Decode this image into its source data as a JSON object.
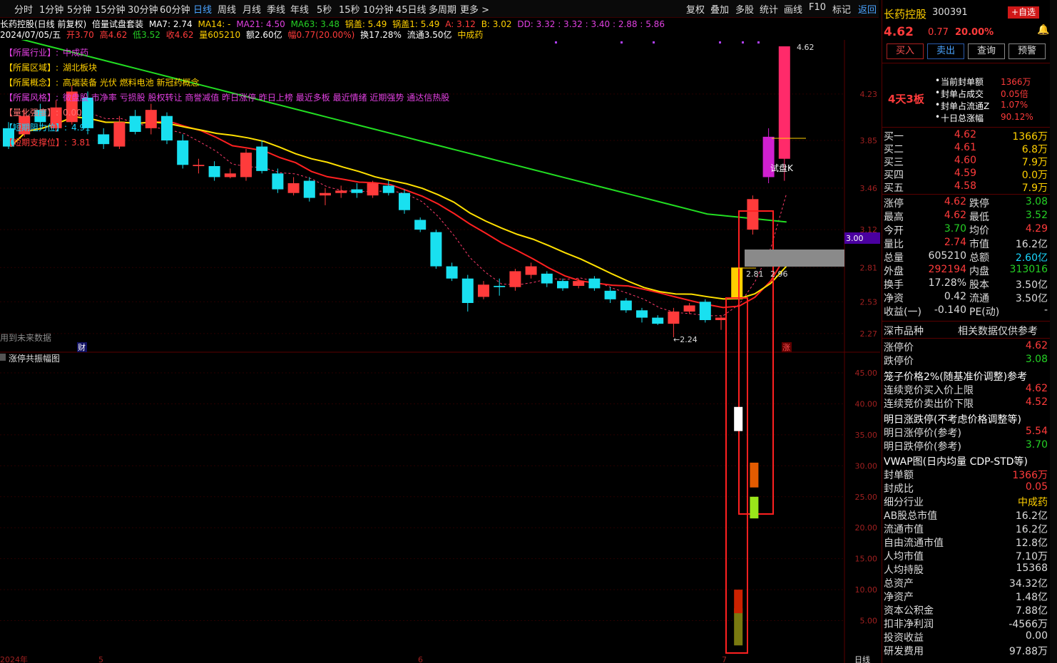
{
  "toolbar": {
    "periods": [
      "分时",
      "1分钟",
      "5分钟",
      "15分钟",
      "30分钟",
      "60分钟",
      "日线",
      "周线",
      "月线",
      "季线",
      "年线",
      "5秒",
      "15秒",
      "10分钟",
      "45日线",
      "多周期",
      "更多 >"
    ],
    "active_period": "日线",
    "tools": [
      "复权",
      "叠加",
      "多股",
      "统计",
      "画线",
      "F10",
      "标记",
      "返回"
    ],
    "active_tool": "返回"
  },
  "info_line1": {
    "stock": "长药控股(日线 前复权)",
    "indicator": "倍量试盘套装",
    "ma7": "MA7: 2.74",
    "ma14": "MA14: -",
    "ma21": "MA21: 4.50",
    "ma63": "MA63: 3.48",
    "guogai": "锅盖: 5.49",
    "guodi": "锅盖1: 5.49",
    "a": "A: 3.12",
    "b": "B: 3.02",
    "dd": "DD: 3.32 : 3.32 : 3.40 : 2.88 : 5.86"
  },
  "info_line2": {
    "date": "2024/07/05/五",
    "open": "开3.70",
    "high": "高4.62",
    "low": "低3.52",
    "close": "收4.62",
    "vol": "量605210",
    "amount": "额2.60亿",
    "range": "幅0.77(20.00%)",
    "turnover": "换17.28%",
    "float": "流通3.50亿",
    "sector": "中成药"
  },
  "attributes": [
    {
      "label": "【所属行业】:",
      "value": "中成药",
      "color": "#e040e0"
    },
    {
      "label": "【所属区域】:",
      "value": "湖北板块",
      "color": "#ffd000"
    },
    {
      "label": "【所属概念】:",
      "value": "高端装备 光伏 燃料电池 新冠药概念",
      "color": "#ffd000"
    },
    {
      "label": "【所属风格】:",
      "value": "微盘股 市净率 亏损股 股权转让 商誉减值 昨日涨停 昨日上榜 最近多板 最近情绪 近期强势 通达信热股",
      "color": "#e040e0"
    },
    {
      "label": "【量化强度】:",
      "value": "0.00",
      "color": "#ff7070"
    },
    {
      "label": "【短期阻力位】:",
      "value": "4.91",
      "color": "#19d7ff"
    },
    {
      "label": "【短期支撑位】:",
      "value": "3.81",
      "color": "#ff3b3b"
    }
  ],
  "chart_labels": {
    "future_data": "用到未来数据",
    "cai": "财",
    "zhang": "涨",
    "trial_k": "试盘K",
    "high_mark": "4.62",
    "low_mark": "←2.24",
    "v281": "2.81",
    "v296": "2.96",
    "sub_title": "涨停共振幅图",
    "price_tag": "3.00",
    "date_left": "2024年",
    "date_mid1": "5",
    "date_mid2": "6",
    "date_mid3": "7",
    "corner": "日线"
  },
  "price_axis": [
    "4.23",
    "3.85",
    "3.46",
    "3.12",
    "2.81",
    "2.53",
    "2.27"
  ],
  "sub_axis": [
    "45.00",
    "40.00",
    "35.00",
    "30.00",
    "25.00",
    "20.00",
    "15.00",
    "10.00",
    "5.00"
  ],
  "quote": {
    "name": "长药控股",
    "code": "300391",
    "add_btn": "+自选",
    "price": "4.62",
    "change": "0.77",
    "pct": "20.00%",
    "buttons": [
      "买入",
      "卖出",
      "查询",
      "预警"
    ],
    "board": "4天3板",
    "seal": [
      {
        "label": "当前封单额",
        "value": "1366万"
      },
      {
        "label": "封单占成交",
        "value": "0.05倍"
      },
      {
        "label": "封单占流通Z",
        "value": "1.07%"
      },
      {
        "label": "十日总涨幅",
        "value": "90.12%"
      }
    ],
    "bids": [
      {
        "label": "买一",
        "price": "4.62",
        "vol": "1366万"
      },
      {
        "label": "买二",
        "price": "4.61",
        "vol": "6.8万"
      },
      {
        "label": "买三",
        "price": "4.60",
        "vol": "7.9万"
      },
      {
        "label": "买四",
        "price": "4.59",
        "vol": "0.0万"
      },
      {
        "label": "买五",
        "price": "4.58",
        "vol": "7.9万"
      }
    ],
    "stats": [
      {
        "l1": "涨停",
        "v1": "4.62",
        "c1": "#ff3b3b",
        "l2": "跌停",
        "v2": "3.08",
        "c2": "#25d025"
      },
      {
        "l1": "最高",
        "v1": "4.62",
        "c1": "#ff3b3b",
        "l2": "最低",
        "v2": "3.52",
        "c2": "#25d025"
      },
      {
        "l1": "今开",
        "v1": "3.70",
        "c1": "#25d025",
        "l2": "均价",
        "v2": "4.29",
        "c2": "#ff3b3b"
      },
      {
        "l1": "量比",
        "v1": "2.74",
        "c1": "#ff3b3b",
        "l2": "市值",
        "v2": "16.2亿",
        "c2": "#dddddd"
      },
      {
        "l1": "总量",
        "v1": "605210",
        "c1": "#dddddd",
        "l2": "总额",
        "v2": "2.60亿",
        "c2": "#19d7ff"
      },
      {
        "l1": "外盘",
        "v1": "292194",
        "c1": "#ff3b3b",
        "l2": "内盘",
        "v2": "313016",
        "c2": "#25d025"
      },
      {
        "l1": "换手",
        "v1": "17.28%",
        "c1": "#dddddd",
        "l2": "股本",
        "v2": "3.50亿",
        "c2": "#dddddd"
      },
      {
        "l1": "净资",
        "v1": "0.42",
        "c1": "#dddddd",
        "l2": "流通",
        "v2": "3.50亿",
        "c2": "#dddddd"
      },
      {
        "l1": "收益(一)",
        "v1": "-0.140",
        "c1": "#dddddd",
        "l2": "PE(动)",
        "v2": "-",
        "c2": "#dddddd"
      }
    ],
    "market_label": "深市品种",
    "market_note": "相关数据仅供参考",
    "limits": [
      {
        "l": "涨停价",
        "v": "4.62",
        "c": "#ff3b3b"
      },
      {
        "l": "跌停价",
        "v": "3.08",
        "c": "#25d025"
      }
    ],
    "cage_title": "笼子价格2%(随基准价调整)参考",
    "cage": [
      {
        "l": "连续竞价买入价上限",
        "v": "4.62",
        "c": "#ff3b3b"
      },
      {
        "l": "连续竞价卖出价下限",
        "v": "4.52",
        "c": "#ff3b3b"
      }
    ],
    "tomorrow_title": "明日涨跌停(不考虑价格调整等)",
    "tomorrow": [
      {
        "l": "明日涨停价(参考)",
        "v": "5.54",
        "c": "#ff3b3b"
      },
      {
        "l": "明日跌停价(参考)",
        "v": "3.70",
        "c": "#25d025"
      }
    ],
    "vwap_title": "VWAP图(日内均量 CDP-STD等)",
    "fund": [
      {
        "l": "封单额",
        "v": "1366万",
        "c": "#ff3b3b"
      },
      {
        "l": "封成比",
        "v": "0.05",
        "c": "#ff3b3b"
      },
      {
        "l": "细分行业",
        "v": "中成药",
        "c": "#ffd000"
      },
      {
        "l": "AB股总市值",
        "v": "16.2亿",
        "c": "#dddddd"
      },
      {
        "l": "流通市值",
        "v": "16.2亿",
        "c": "#dddddd"
      },
      {
        "l": "自由流通市值",
        "v": "12.8亿",
        "c": "#dddddd"
      },
      {
        "l": "人均市值",
        "v": "7.10万",
        "c": "#dddddd"
      },
      {
        "l": "人均持股",
        "v": "15368",
        "c": "#dddddd"
      },
      {
        "l": "总资产",
        "v": "34.32亿",
        "c": "#dddddd"
      },
      {
        "l": "净资产",
        "v": "1.48亿",
        "c": "#dddddd"
      },
      {
        "l": "资本公积金",
        "v": "7.88亿",
        "c": "#dddddd"
      },
      {
        "l": "扣非净利润",
        "v": "-4566万",
        "c": "#dddddd"
      },
      {
        "l": "投资收益",
        "v": "0.00",
        "c": "#dddddd"
      },
      {
        "l": "研发费用",
        "v": "97.88万",
        "c": "#dddddd"
      }
    ]
  },
  "candles": [
    {
      "o": 3.95,
      "c": 3.8,
      "h": 4.0,
      "l": 3.78
    },
    {
      "o": 3.9,
      "c": 4.05,
      "h": 4.1,
      "l": 3.88
    },
    {
      "o": 4.1,
      "c": 4.0,
      "h": 4.15,
      "l": 3.95
    },
    {
      "o": 3.95,
      "c": 4.12,
      "h": 4.18,
      "l": 3.92
    },
    {
      "o": 4.0,
      "c": 4.25,
      "h": 4.3,
      "l": 3.98
    },
    {
      "o": 4.2,
      "c": 3.95,
      "h": 4.25,
      "l": 3.9
    },
    {
      "o": 3.9,
      "c": 3.82,
      "h": 3.95,
      "l": 3.78
    },
    {
      "o": 3.8,
      "c": 4.0,
      "h": 4.05,
      "l": 3.78
    },
    {
      "o": 4.05,
      "c": 3.92,
      "h": 4.1,
      "l": 3.9
    },
    {
      "o": 3.95,
      "c": 4.1,
      "h": 4.15,
      "l": 3.9
    },
    {
      "o": 4.05,
      "c": 3.85,
      "h": 4.08,
      "l": 3.82
    },
    {
      "o": 3.85,
      "c": 3.65,
      "h": 3.9,
      "l": 3.62
    },
    {
      "o": 3.64,
      "c": 3.65,
      "h": 3.7,
      "l": 3.58
    },
    {
      "o": 3.64,
      "c": 3.55,
      "h": 3.68,
      "l": 3.52
    },
    {
      "o": 3.55,
      "c": 3.58,
      "h": 3.62,
      "l": 3.54
    },
    {
      "o": 3.55,
      "c": 3.75,
      "h": 3.78,
      "l": 3.52
    },
    {
      "o": 3.8,
      "c": 3.6,
      "h": 3.85,
      "l": 3.58
    },
    {
      "o": 3.58,
      "c": 3.45,
      "h": 3.62,
      "l": 3.42
    },
    {
      "o": 3.42,
      "c": 3.5,
      "h": 3.55,
      "l": 3.4
    },
    {
      "o": 3.52,
      "c": 3.38,
      "h": 3.55,
      "l": 3.35
    },
    {
      "o": 3.4,
      "c": 3.42,
      "h": 3.46,
      "l": 3.32
    },
    {
      "o": 3.42,
      "c": 3.44,
      "h": 3.48,
      "l": 3.38
    },
    {
      "o": 3.45,
      "c": 3.42,
      "h": 3.5,
      "l": 3.38
    },
    {
      "o": 3.4,
      "c": 3.5,
      "h": 3.52,
      "l": 3.38
    },
    {
      "o": 3.48,
      "c": 3.42,
      "h": 3.52,
      "l": 3.4
    },
    {
      "o": 3.42,
      "c": 3.28,
      "h": 3.45,
      "l": 3.25
    },
    {
      "o": 3.2,
      "c": 3.12,
      "h": 3.22,
      "l": 3.1
    },
    {
      "o": 3.1,
      "c": 2.82,
      "h": 3.12,
      "l": 2.8
    },
    {
      "o": 2.82,
      "c": 2.72,
      "h": 2.85,
      "l": 2.7
    },
    {
      "o": 2.72,
      "c": 2.52,
      "h": 2.75,
      "l": 2.45
    },
    {
      "o": 2.57,
      "c": 2.67,
      "h": 2.7,
      "l": 2.55
    },
    {
      "o": 2.66,
      "c": 2.65,
      "h": 2.72,
      "l": 2.58
    },
    {
      "o": 2.65,
      "c": 2.78,
      "h": 2.8,
      "l": 2.62
    },
    {
      "o": 2.75,
      "c": 2.82,
      "h": 2.85,
      "l": 2.72
    },
    {
      "o": 2.76,
      "c": 2.68,
      "h": 2.78,
      "l": 2.65
    },
    {
      "o": 2.7,
      "c": 2.64,
      "h": 2.72,
      "l": 2.62
    },
    {
      "o": 2.66,
      "c": 2.7,
      "h": 2.72,
      "l": 2.64
    },
    {
      "o": 2.72,
      "c": 2.64,
      "h": 2.74,
      "l": 2.62
    },
    {
      "o": 2.62,
      "c": 2.55,
      "h": 2.65,
      "l": 2.52
    },
    {
      "o": 2.54,
      "c": 2.46,
      "h": 2.56,
      "l": 2.44
    },
    {
      "o": 2.46,
      "c": 2.4,
      "h": 2.48,
      "l": 2.36
    },
    {
      "o": 2.4,
      "c": 2.35,
      "h": 2.42,
      "l": 2.34
    },
    {
      "o": 2.35,
      "c": 2.45,
      "h": 2.48,
      "l": 2.24
    },
    {
      "o": 2.45,
      "c": 2.5,
      "h": 2.52,
      "l": 2.43
    },
    {
      "o": 2.53,
      "c": 2.38,
      "h": 2.55,
      "l": 2.36
    },
    {
      "o": 2.38,
      "c": 2.4,
      "h": 2.42,
      "l": 2.3
    },
    {
      "o": 2.55,
      "c": 2.81,
      "h": 2.81,
      "l": 2.55
    },
    {
      "o": 3.12,
      "c": 3.37,
      "h": 3.4,
      "l": 3.08
    },
    {
      "o": 3.55,
      "c": 3.88,
      "h": 3.95,
      "l": 3.5
    },
    {
      "o": 3.7,
      "c": 4.62,
      "h": 4.62,
      "l": 3.52
    }
  ],
  "sub_bars": [
    {
      "idx": 46,
      "v": 7.0,
      "base": 1.0,
      "color": "#7a7a10"
    },
    {
      "idx": 46,
      "v": 10.0,
      "base": 6.2,
      "color": "#cc2200"
    },
    {
      "idx": 46,
      "v": 39.5,
      "base": 35.6,
      "color": "#ffffff"
    },
    {
      "idx": 47,
      "v": 30.5,
      "base": 26.5,
      "color": "#e35b00"
    },
    {
      "idx": 47,
      "v": 25.0,
      "base": 21.5,
      "color": "#9ae61a"
    }
  ]
}
